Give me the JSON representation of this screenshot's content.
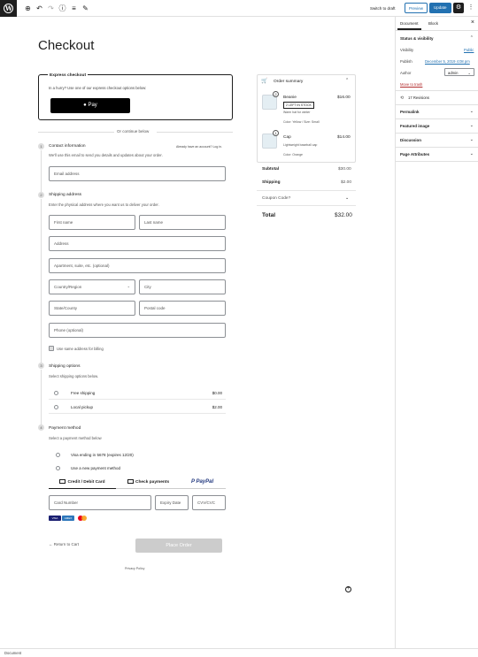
{
  "toolbar": {
    "switch_draft": "Switch to draft",
    "preview": "Preview",
    "update": "Update"
  },
  "sidebar": {
    "tabs": [
      "Document",
      "Block"
    ],
    "status_title": "Status & visibility",
    "visibility_label": "Visibility",
    "visibility_value": "Public",
    "publish_label": "Publish",
    "publish_value": "December 5, 2019 4:08 pm",
    "author_label": "Author",
    "author_value": "admin",
    "trash_link": "Move to trash",
    "revisions": "17 Revisions",
    "panels": [
      "Permalink",
      "Featured image",
      "Discussion",
      "Page Attributes"
    ]
  },
  "status_bar": "Document",
  "page": {
    "title": "Checkout",
    "express_title": "Express checkout",
    "express_desc": "In a hurry? Use one of our express checkout options below:",
    "apple_pay": " Pay",
    "or_continue": "Or continue below",
    "contact": {
      "number": "1",
      "title": "Contact information",
      "right_note": "Already have an account? Log in.",
      "desc": "We'll use this email to send you details and updates about your order.",
      "email_placeholder": "Email address"
    },
    "shipping_address": {
      "number": "2",
      "title": "Shipping address",
      "desc": "Enter the physical address where you want us to deliver your order.",
      "first_name": "First name",
      "last_name": "Last name",
      "address": "Address",
      "apartment": "Apartment, suite, etc. (optional)",
      "country": "Country/Region",
      "city": "City",
      "state": "State/County",
      "postal": "Postal code",
      "phone": "Phone (optional)",
      "same_billing": "Use same address for billing"
    },
    "shipping_options": {
      "number": "3",
      "title": "Shipping options",
      "desc": "Select shipping options below.",
      "options": [
        {
          "label": "Free shipping",
          "price": "$0.00"
        },
        {
          "label": "Local pickup",
          "price": "$2.00"
        }
      ]
    },
    "payment": {
      "number": "4",
      "title": "Payment method",
      "desc": "Select a payment method below",
      "saved_card": "Visa ending in 5678 (expires 12/20)",
      "new_method": "Use a new payment method",
      "tabs": [
        "Credit / Debit Card",
        "Check payments",
        "PayPal"
      ],
      "card_number": "Card Number",
      "expiry": "Expiry Date",
      "cvc": "CVV/CVC",
      "cards": [
        "VISA",
        "AMEX",
        "MC"
      ]
    },
    "return_cart": "Return to Cart",
    "place_order": "Place Order",
    "privacy": "Privacy Policy"
  },
  "summary": {
    "title": "Order summary",
    "items": [
      {
        "qty": "2",
        "name": "Beanie",
        "price": "$16.00",
        "stock": "2 LEFT IN STOCK",
        "desc": "Warm hat for winter",
        "attr": "Color: Yellow / Size: Small"
      },
      {
        "qty": "1",
        "name": "Cap",
        "price": "$14.00",
        "desc": "Lightweight baseball cap",
        "attr": "Color: Orange"
      }
    ],
    "subtotal_label": "Subtotal",
    "subtotal": "$30.00",
    "shipping_label": "Shipping",
    "shipping": "$2.00",
    "coupon": "Coupon Code?",
    "total_label": "Total",
    "total": "$32.00"
  }
}
